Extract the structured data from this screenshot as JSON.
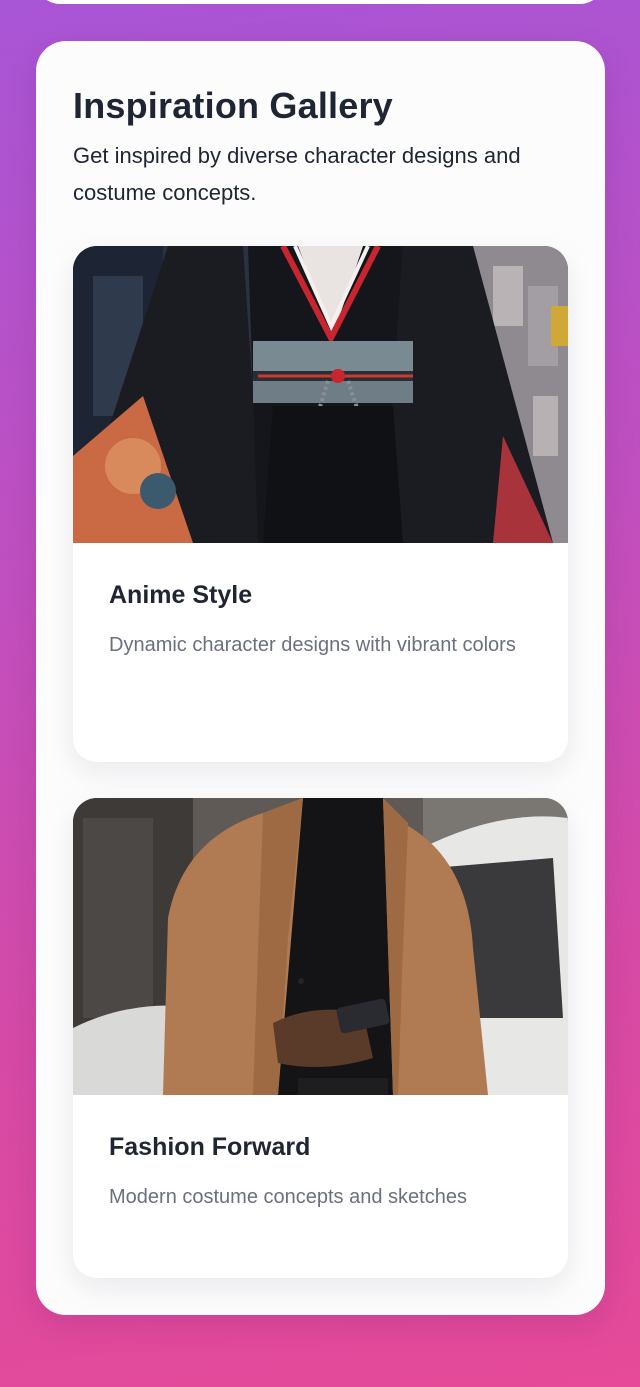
{
  "gallery": {
    "title": "Inspiration Gallery",
    "subtitle": "Get inspired by diverse character designs and costume concepts.",
    "cards": [
      {
        "title": "Anime Style",
        "description": "Dynamic character designs with vibrant colors",
        "image": "kimono-costume-photo"
      },
      {
        "title": "Fashion Forward",
        "description": "Modern costume concepts and sketches",
        "image": "man-in-camel-coat-photo"
      }
    ]
  },
  "colors": {
    "background_start": "#a855d6",
    "background_end": "#e64a98",
    "panel": "#fcfcfd",
    "heading_text": "#1f2533",
    "muted_text": "#6b7080"
  }
}
